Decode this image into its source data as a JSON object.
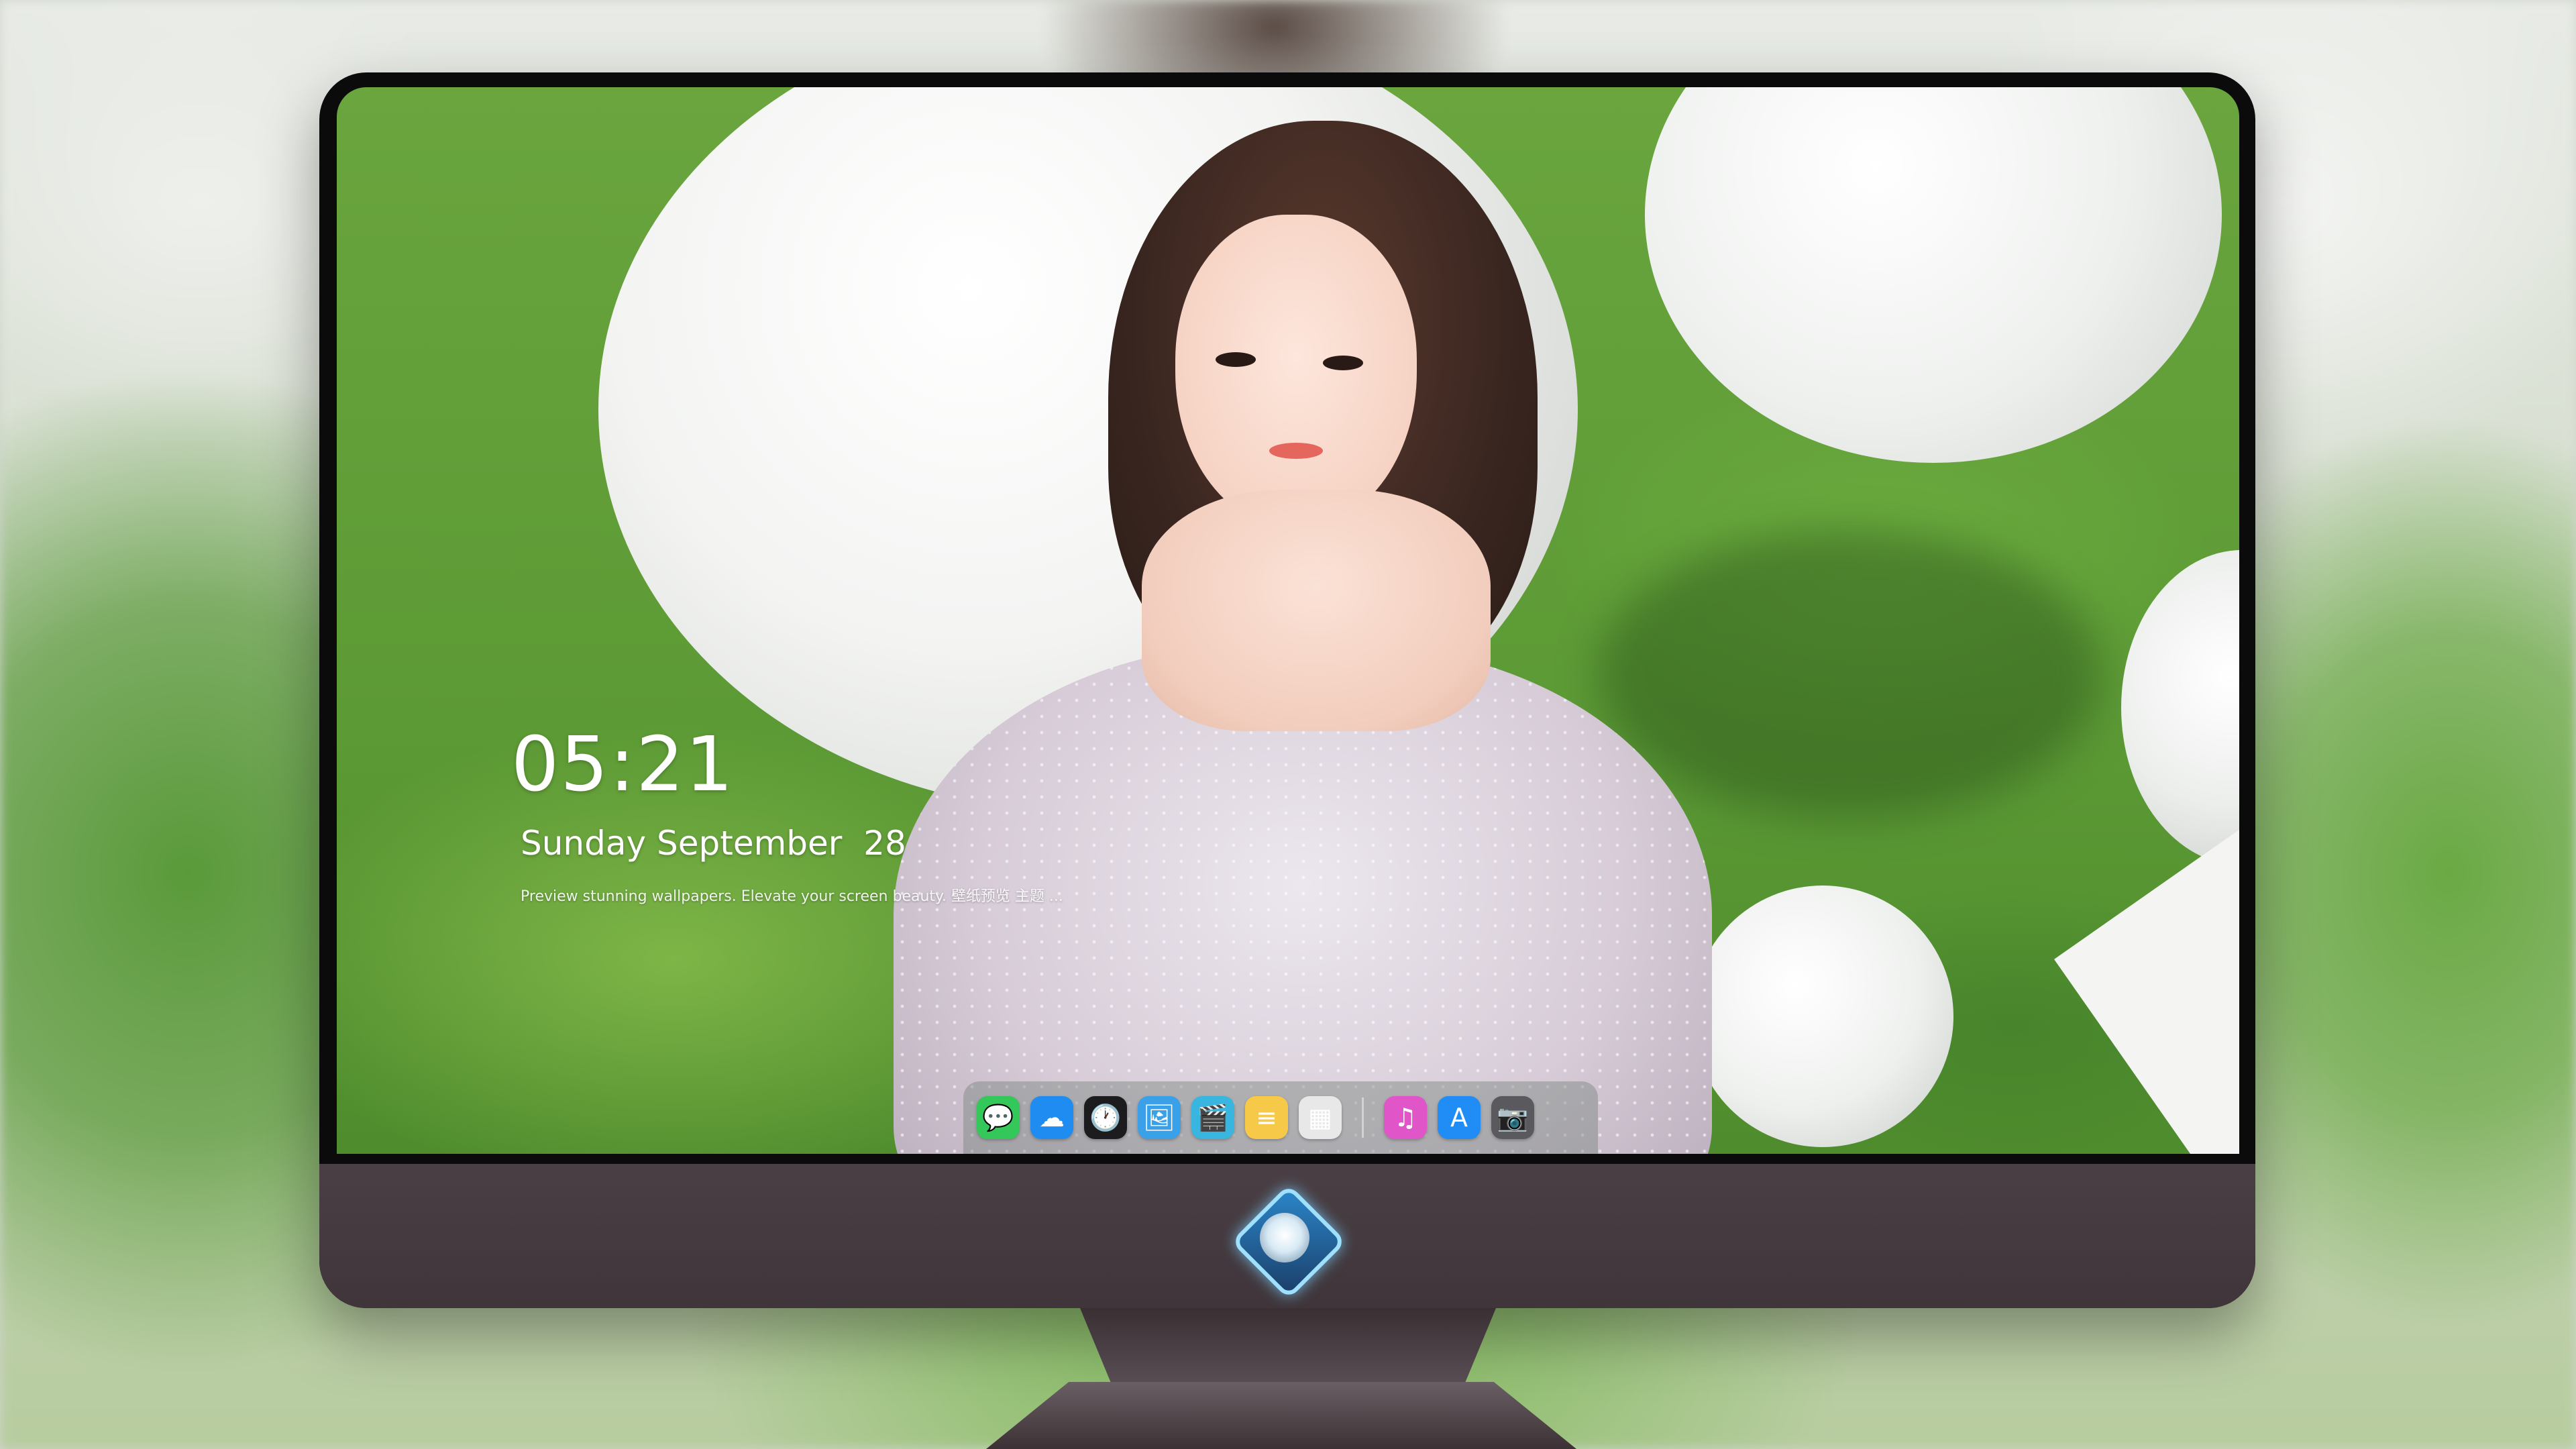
{
  "lockscreen": {
    "time": "05:21",
    "date": "Sunday September  28",
    "tagline": "Preview stunning wallpapers. Elevate your screen beauty. 壁纸预览 主题 ..."
  },
  "dock": {
    "apps": [
      {
        "name": "messages-icon",
        "glyph": "💬",
        "color": "#34c759"
      },
      {
        "name": "weather-icon",
        "glyph": "☁",
        "color": "#1e8cf0"
      },
      {
        "name": "clock-icon",
        "glyph": "🕐",
        "color": "#1c1c1e"
      },
      {
        "name": "preview-icon",
        "glyph": "🖼",
        "color": "#3aa0e8"
      },
      {
        "name": "video-editor-icon",
        "glyph": "🎬",
        "color": "#38b6e0"
      },
      {
        "name": "notes-icon",
        "glyph": "≡",
        "color": "#f7c948"
      },
      {
        "name": "photo-gallery-icon",
        "glyph": "▦",
        "color": "#e8e8e8"
      },
      {
        "name": "music-icon",
        "glyph": "♫",
        "color": "#e056c8"
      },
      {
        "name": "app-store-icon",
        "glyph": "A",
        "color": "#1f8df5"
      },
      {
        "name": "camera-icon",
        "glyph": "📷",
        "color": "#5a5a5e"
      }
    ]
  }
}
